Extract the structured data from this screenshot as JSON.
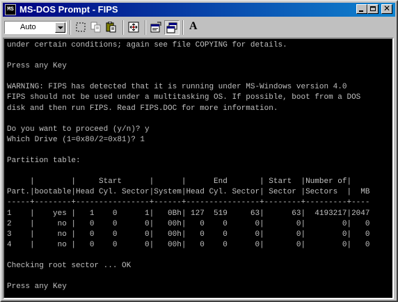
{
  "window": {
    "title": "MS-DOS Prompt - FIPS",
    "title_icon_text": "MS"
  },
  "toolbar": {
    "font_size_value": "Auto",
    "tools": [
      {
        "name": "mark-icon"
      },
      {
        "name": "copy-icon"
      },
      {
        "name": "paste-icon"
      },
      {
        "name": "full-screen-icon"
      },
      {
        "name": "properties-icon"
      },
      {
        "name": "background-icon"
      },
      {
        "name": "font-icon",
        "label": "A"
      }
    ]
  },
  "console": {
    "lines": [
      "under certain conditions; again see file COPYING for details.",
      "",
      "Press any Key",
      "",
      "WARNING: FIPS has detected that it is running under MS-Windows version 4.0",
      "FIPS should not be used under a multitasking OS. If possible, boot from a DOS",
      "disk and then run FIPS. Read FIPS.DOC for more information.",
      "",
      "Do you want to proceed (y/n)? y",
      "Which Drive (1=0x80/2=0x81)? 1",
      "",
      "Partition table:",
      "",
      "     |        |     Start      |      |      End       | Start  |Number of|",
      "Part.|bootable|Head Cyl. Sector|System|Head Cyl. Sector| Sector |Sectors  |  MB",
      "-----+--------+----------------+------+----------------+--------+---------+----",
      "1    |    yes |   1    0      1|   0Bh| 127  519     63|      63|  4193217|2047",
      "2    |     no |   0    0      0|   00h|   0    0      0|       0|        0|   0",
      "3    |     no |   0    0      0|   00h|   0    0      0|       0|        0|   0",
      "4    |     no |   0    0      0|   00h|   0    0      0|       0|        0|   0",
      "",
      "Checking root sector ... OK",
      "",
      "Press any Key"
    ]
  },
  "colors": {
    "titlebar_start": "#000080",
    "titlebar_end": "#1084d0",
    "console_bg": "#000000",
    "console_fg": "#c0c0c0",
    "chrome": "#c0c0c0"
  }
}
